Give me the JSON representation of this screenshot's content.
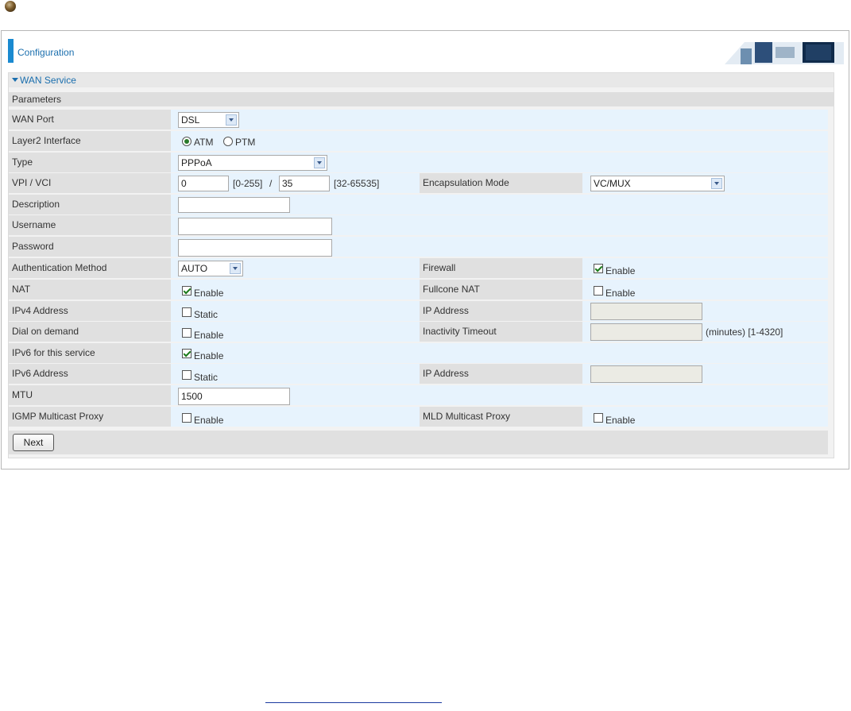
{
  "header": {
    "title": "Configuration"
  },
  "section": {
    "title": "WAN Service",
    "params_label": "Parameters"
  },
  "rows": {
    "wan_port": {
      "label": "WAN Port",
      "value": "DSL"
    },
    "layer2": {
      "label": "Layer2 Interface",
      "opt1": "ATM",
      "opt2": "PTM",
      "selected": "ATM"
    },
    "type": {
      "label": "Type",
      "value": "PPPoA"
    },
    "vpi_vci": {
      "label": "VPI / VCI",
      "vpi": "0",
      "vpi_range": "[0-255]",
      "sep": "/",
      "vci": "35",
      "vci_range": "[32-65535]"
    },
    "encap": {
      "label": "Encapsulation Mode",
      "value": "VC/MUX"
    },
    "description": {
      "label": "Description",
      "value": ""
    },
    "username": {
      "label": "Username",
      "value": ""
    },
    "password": {
      "label": "Password",
      "value": ""
    },
    "auth": {
      "label": "Authentication Method",
      "value": "AUTO"
    },
    "firewall": {
      "label": "Firewall",
      "check_label": "Enable",
      "checked": true
    },
    "nat": {
      "label": "NAT",
      "check_label": "Enable",
      "checked": true
    },
    "fullcone": {
      "label": "Fullcone NAT",
      "check_label": "Enable",
      "checked": false
    },
    "ipv4": {
      "label": "IPv4 Address",
      "check_label": "Static",
      "checked": false
    },
    "ipv4_addr": {
      "label": "IP Address",
      "value": ""
    },
    "dial": {
      "label": "Dial on demand",
      "check_label": "Enable",
      "checked": false
    },
    "inactivity": {
      "label": "Inactivity Timeout",
      "value": "",
      "unit": "(minutes)  [1-4320]"
    },
    "ipv6_service": {
      "label": "IPv6 for this service",
      "check_label": "Enable",
      "checked": true
    },
    "ipv6": {
      "label": "IPv6 Address",
      "check_label": "Static",
      "checked": false
    },
    "ipv6_addr": {
      "label": "IP Address",
      "value": ""
    },
    "mtu": {
      "label": "MTU",
      "value": "1500"
    },
    "igmp": {
      "label": "IGMP Multicast Proxy",
      "check_label": "Enable",
      "checked": false
    },
    "mld": {
      "label": "MLD Multicast Proxy",
      "check_label": "Enable",
      "checked": false
    }
  },
  "buttons": {
    "next": "Next"
  },
  "colors": {
    "accent": "#1a8ad0",
    "row_bg": "#e7f3fd",
    "label_bg": "#e0e0e0"
  }
}
